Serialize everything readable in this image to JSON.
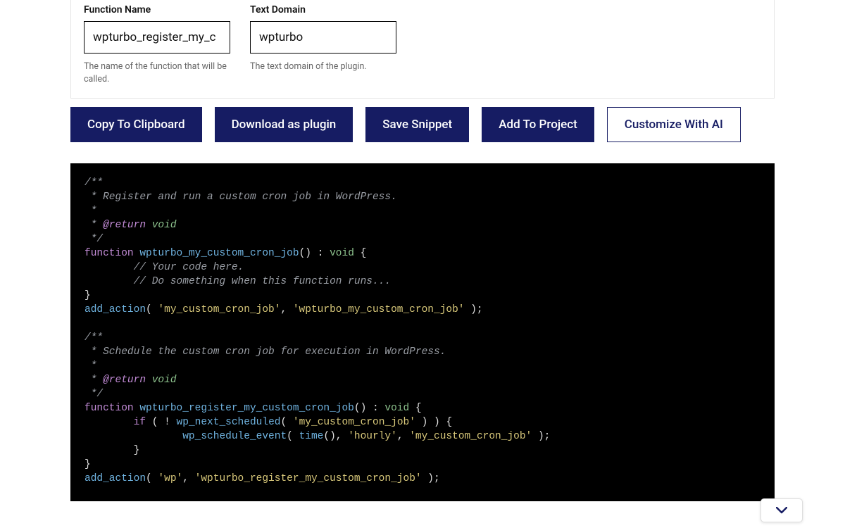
{
  "form": {
    "function_name": {
      "label": "Function Name",
      "value": "wpturbo_register_my_c",
      "hint": "The name of the function that will be called."
    },
    "text_domain": {
      "label": "Text Domain",
      "value": "wpturbo",
      "hint": "The text domain of the plugin."
    }
  },
  "buttons": {
    "copy": "Copy To Clipboard",
    "download": "Download as plugin",
    "save": "Save Snippet",
    "add": "Add To Project",
    "customize": "Customize With AI"
  },
  "code": {
    "c1a": "/**",
    "c1b": " * Register and run a custom cron job in WordPress.",
    "c1c": " *",
    "c1d_prefix": " * ",
    "c1d_return": "@return",
    "c1d_sp": " ",
    "c1d_void": "void",
    "c1e": " */",
    "fn1_kw": "function",
    "fn1_sp": " ",
    "fn1_name": "wpturbo_my_custom_cron_job",
    "fn1_paren": "()",
    "fn1_sp2": " ",
    "fn1_colon": ":",
    "fn1_sp3": " ",
    "fn1_void": "void",
    "fn1_sp4": " ",
    "fn1_brace": "{",
    "lc1_pad": "        ",
    "lc1": "// Your code here.",
    "lc2_pad": "        ",
    "lc2": "// Do something when this function runs...",
    "fn1_close": "}",
    "aa1_call": "add_action",
    "aa1_open": "( ",
    "aa1_s1": "'my_custom_cron_job'",
    "aa1_comma": ", ",
    "aa1_s2": "'wpturbo_my_custom_cron_job'",
    "aa1_close": " );",
    "blank": "",
    "c2a": "/**",
    "c2b": " * Schedule the custom cron job for execution in WordPress.",
    "c2c": " *",
    "c2e": " */",
    "fn2_kw": "function",
    "fn2_sp": " ",
    "fn2_name": "wpturbo_register_my_custom_cron_job",
    "fn2_paren": "()",
    "fn2_sp2": " ",
    "fn2_colon": ":",
    "fn2_sp3": " ",
    "fn2_void": "void",
    "fn2_sp4": " ",
    "fn2_brace": "{",
    "if_pad": "        ",
    "if_kw": "if",
    "if_open": " ( ",
    "if_bang": "! ",
    "if_call": "wp_next_scheduled",
    "if_popen": "( ",
    "if_s1": "'my_custom_cron_job'",
    "if_pclose": " ) ) ",
    "if_brace": "{",
    "sch_pad": "                ",
    "sch_call": "wp_schedule_event",
    "sch_open": "( ",
    "sch_time": "time",
    "sch_tparen": "()",
    "sch_comma1": ", ",
    "sch_s1": "'hourly'",
    "sch_comma2": ", ",
    "sch_s2": "'my_custom_cron_job'",
    "sch_close": " );",
    "ifc_pad": "        ",
    "ifc_close": "}",
    "fn2_close": "}",
    "aa2_call": "add_action",
    "aa2_open": "( ",
    "aa2_s1": "'wp'",
    "aa2_comma": ", ",
    "aa2_s2": "'wpturbo_register_my_custom_cron_job'",
    "aa2_close": " );"
  }
}
